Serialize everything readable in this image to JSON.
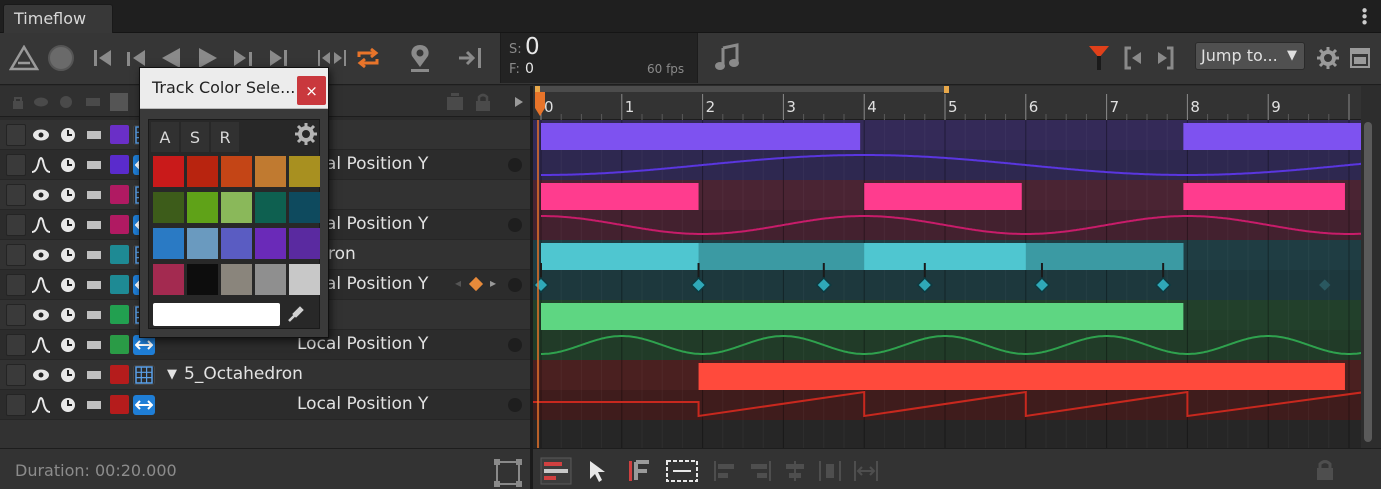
{
  "window": {
    "tab_title": "Timeflow",
    "menu_icon": "kebab-menu-icon"
  },
  "toolbar": {
    "frame_s_label": "S:",
    "frame_s_value": "0",
    "frame_f_label": "F:",
    "frame_f_value": "0",
    "fps": "60 fps",
    "jump_label": "Jump to...",
    "accent_color": "#e8742a",
    "marker_color": "#e0401a"
  },
  "ruler": {
    "ticks": [
      "0",
      "1",
      "2",
      "3",
      "4",
      "5",
      "6",
      "7",
      "8",
      "9"
    ]
  },
  "tracks": [
    {
      "name": "",
      "type": "object",
      "color": "#6a2fc7",
      "visible_name": ""
    },
    {
      "name": "Local Position Y",
      "type": "curve",
      "color": "#5a2bcc"
    },
    {
      "name": "",
      "type": "object",
      "color": "#b01a62"
    },
    {
      "name": "Local Position Y",
      "type": "curve",
      "color": "#b01a62"
    },
    {
      "name": "ron",
      "type": "object",
      "color": "#1e8a94"
    },
    {
      "name": "Local Position Y",
      "type": "curve",
      "color": "#1e8a94"
    },
    {
      "name": "",
      "type": "object",
      "color": "#22a050"
    },
    {
      "name": "Local Position Y",
      "type": "curve",
      "color": "#2a9b46"
    },
    {
      "name": "5_Octahedron",
      "type": "object",
      "color": "#b51c1c"
    },
    {
      "name": "Local Position Y",
      "type": "curve",
      "color": "#b51c1c"
    }
  ],
  "popup": {
    "title": "Track Color Sele...",
    "close_label": "×",
    "tabs": [
      "A",
      "S",
      "R"
    ],
    "hex_value": "",
    "swatches": [
      "#c91a1a",
      "#b8240f",
      "#c44516",
      "#c07a30",
      "#a89020",
      "#3d5c1a",
      "#5fa218",
      "#8ab85a",
      "#0e6050",
      "#0e4a5e",
      "#2a7ac4",
      "#6a9abf",
      "#5a5cc2",
      "#6a2ab8",
      "#5a2aa0",
      "#a32a50",
      "#0d0d0d",
      "#8a857c",
      "#8f8f8f",
      "#c8c8c8"
    ]
  },
  "footer": {
    "duration": "Duration: 00:20.000"
  }
}
